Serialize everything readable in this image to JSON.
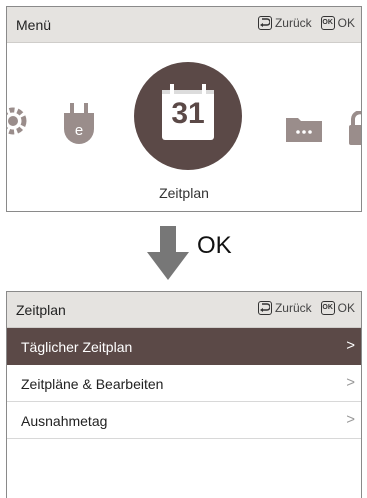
{
  "menu_screen": {
    "title": "Menü",
    "back_label": "Zurück",
    "ok_key": "OK",
    "ok_label": "OK",
    "selected_item": "Zeitplan",
    "calendar_number": "31"
  },
  "arrow_label": "OK",
  "schedule_screen": {
    "title": "Zeitplan",
    "back_label": "Zurück",
    "ok_key": "OK",
    "ok_label": "OK",
    "items": [
      {
        "label": "Täglicher Zeitplan",
        "chevron": ">"
      },
      {
        "label": "Zeitpläne & Bearbeiten",
        "chevron": ">"
      },
      {
        "label": "Ausnahmetag",
        "chevron": ">"
      }
    ]
  },
  "colors": {
    "accent": "#5b4947",
    "header_bg": "#e5e3e0",
    "icon_gray": "#9a8d8b"
  }
}
